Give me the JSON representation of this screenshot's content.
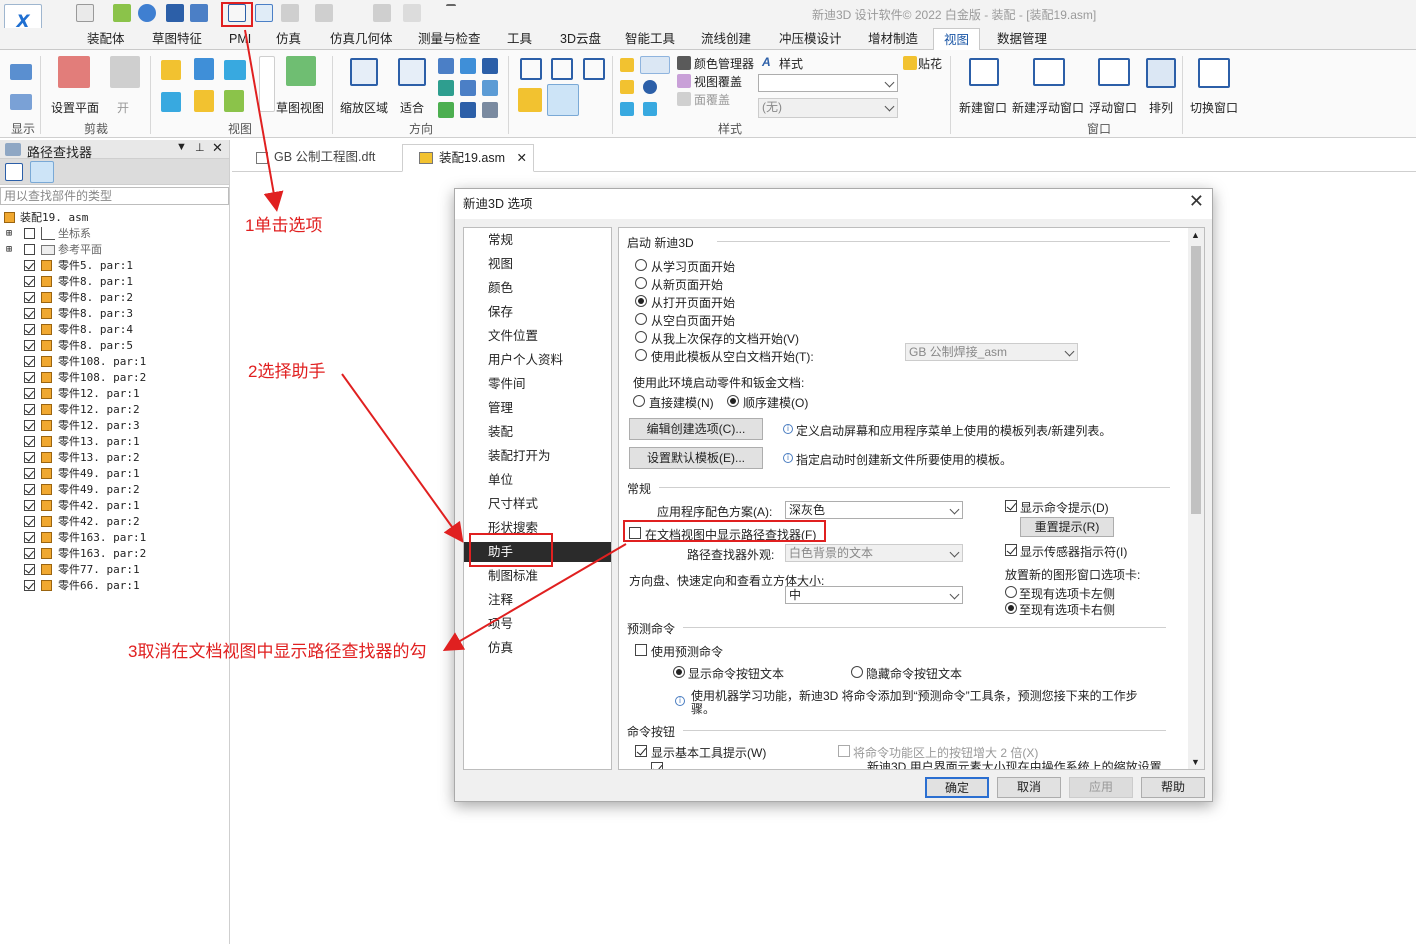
{
  "app": {
    "title": "新迪3D 设计软件© 2022 白金版 - 装配 - [装配19.asm]",
    "logo_text": "X"
  },
  "ribbon_tabs": [
    "装配体",
    "草图特征",
    "PMI",
    "仿真",
    "仿真几何体",
    "测量与检查",
    "工具",
    "3D云盘",
    "智能工具",
    "流线创建",
    "冲压模设计",
    "增材制造",
    "视图",
    "数据管理"
  ],
  "active_tab": "视图",
  "ribbon": {
    "items": {
      "set_plane": "设置平面",
      "open": "开",
      "sketch_view": "草图视图",
      "zoom_area": "缩放区域",
      "fit": "适合",
      "color_manager": "颜色管理器",
      "view_overlay": "视图覆盖",
      "face_overlay": "面覆盖",
      "style": "样式",
      "style_none": "(无)",
      "decal": "贴花",
      "new_window": "新建窗口",
      "new_float_window": "新建浮动窗口",
      "float_window": "浮动窗口",
      "arrange": "排列",
      "switch_window": "切换窗口"
    },
    "groups": [
      "显示",
      "剪裁",
      "视图",
      "方向",
      "样式",
      "窗口"
    ]
  },
  "left_panel": {
    "title": "路径查找器",
    "search_placeholder": "用以查找部件的类型",
    "root": "装配19. asm",
    "folders": [
      "坐标系",
      "参考平面"
    ],
    "parts": [
      "零件5. par:1",
      "零件8. par:1",
      "零件8. par:2",
      "零件8. par:3",
      "零件8. par:4",
      "零件8. par:5",
      "零件108. par:1",
      "零件108. par:2",
      "零件12. par:1",
      "零件12. par:2",
      "零件12. par:3",
      "零件13. par:1",
      "零件13. par:2",
      "零件49. par:1",
      "零件49. par:2",
      "零件42. par:1",
      "零件42. par:2",
      "零件163. par:1",
      "零件163. par:2",
      "零件77. par:1",
      "零件66. par:1"
    ]
  },
  "doc_tabs": [
    "GB 公制工程图.dft",
    "装配19.asm"
  ],
  "dialog": {
    "title": "新迪3D 选项",
    "nav": [
      "常规",
      "视图",
      "颜色",
      "保存",
      "文件位置",
      "用户个人资料",
      "零件间",
      "管理",
      "装配",
      "装配打开为",
      "单位",
      "尺寸样式",
      "形状搜索",
      "助手",
      "制图标准",
      "注释",
      "项号",
      "仿真"
    ],
    "nav_selected": "助手",
    "content": {
      "startup_header": "启动 新迪3D",
      "startup_options": [
        "从学习页面开始",
        "从新页面开始",
        "从打开页面开始",
        "从空白页面开始",
        "从我上次保存的文档开始(V)",
        "使用此模板从空白文档开始(T):"
      ],
      "startup_selected": 2,
      "template_combo": "GB 公制焊接_asm",
      "env_label": "使用此环境启动零件和钣金文档:",
      "env_options": [
        "直接建模(N)",
        "顺序建模(O)"
      ],
      "env_selected": 1,
      "edit_create_btn": "编辑创建选项(C)...",
      "edit_create_info": "定义启动屏幕和应用程序菜单上使用的模板列表/新建列表。",
      "set_template_btn": "设置默认模板(E)...",
      "set_template_info": "指定启动时创建新文件所要使用的模板。",
      "general_header": "常规",
      "color_scheme_label": "应用程序配色方案(A):",
      "color_scheme_value": "深灰色",
      "show_pathfinder_label": "在文档视图中显示路径查找器(F)",
      "show_pathfinder_checked": false,
      "pathfinder_look_label": "路径查找器外观:",
      "pathfinder_look_value": "白色背景的文本",
      "cube_size_label": "方向盘、快速定向和查看立方体大小:",
      "cube_size_value": "中",
      "show_cmd_tips": "显示命令提示(D)",
      "reset_tips_btn": "重置提示(R)",
      "show_sensor": "显示传感器指示符(I)",
      "new_window_tab_label": "放置新的图形窗口选项卡:",
      "tab_pos_options": [
        "至现有选项卡左侧",
        "至现有选项卡右侧"
      ],
      "tab_pos_selected": 1,
      "predict_header": "预测命令",
      "use_predict": "使用预测命令",
      "show_btn_text": "显示命令按钮文本",
      "hide_btn_text": "隐藏命令按钮文本",
      "predict_info": "使用机器学习功能，新迪3D 将命令添加到“预测命令”工具条，预测您接下来的工作步骤。",
      "cmd_btn_header": "命令按钮",
      "show_basic_tips": "显示基本工具提示(W)",
      "enlarge_btns": "将命令功能区上的按钮增大 2 倍(X)",
      "ui_scale_note": "新迪3D 用户界面元素大小现在由操作系统上的缩放设置"
    },
    "buttons": {
      "ok": "确定",
      "cancel": "取消",
      "apply": "应用",
      "help": "帮助"
    }
  },
  "annotations": {
    "step1": "1单击选项",
    "step2": "2选择助手",
    "step3": "3取消在文档视图中显示路径查找器的勾",
    "color": "#e02020"
  }
}
